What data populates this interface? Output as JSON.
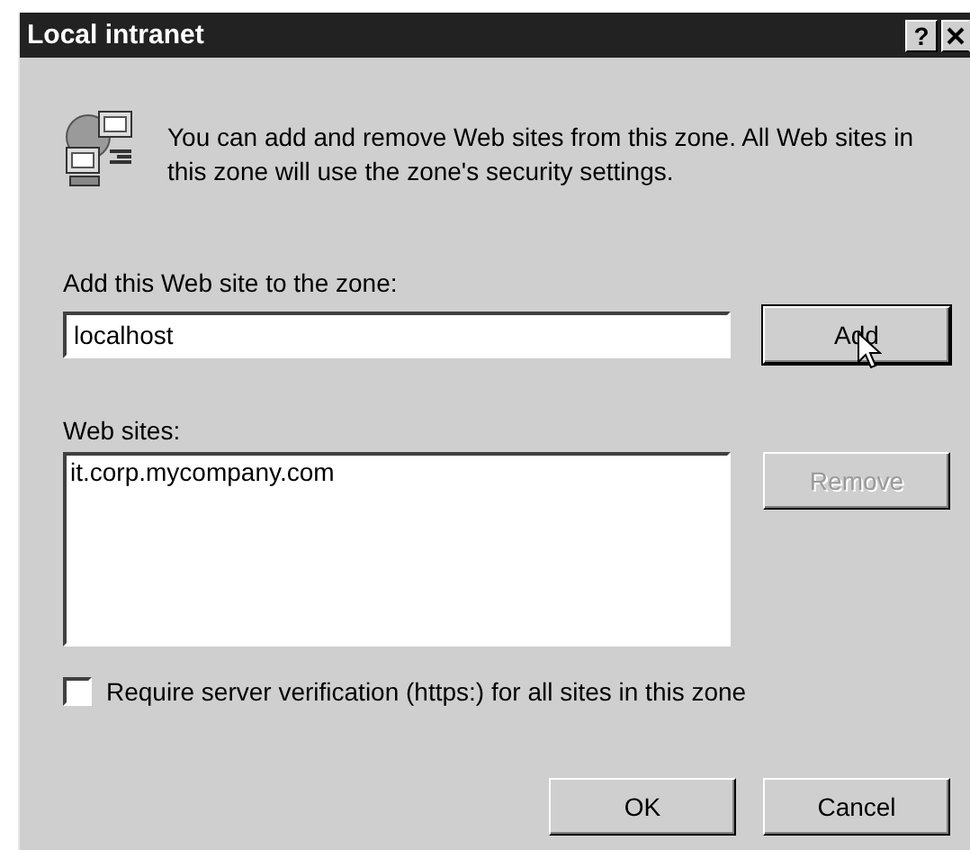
{
  "window": {
    "title": "Local intranet",
    "help_button": "?"
  },
  "description": "You can add and remove Web sites from this zone. All Web sites in this zone will use the zone's security settings.",
  "add_field": {
    "label": "Add this Web site to the zone:",
    "value": "localhost"
  },
  "add_button": {
    "label": "Add",
    "disabled": false,
    "focused": true
  },
  "sites": {
    "label": "Web sites:",
    "items": [
      {
        "text": "it.corp.mycompany.com",
        "selected": false
      }
    ]
  },
  "remove_button": {
    "label": "Remove",
    "disabled": true
  },
  "https_checkbox": {
    "label": "Require server verification (https:) for all sites in this zone",
    "checked": false
  },
  "buttons": [
    {
      "label": "OK",
      "disabled": false
    },
    {
      "label": "Cancel",
      "disabled": false
    }
  ]
}
